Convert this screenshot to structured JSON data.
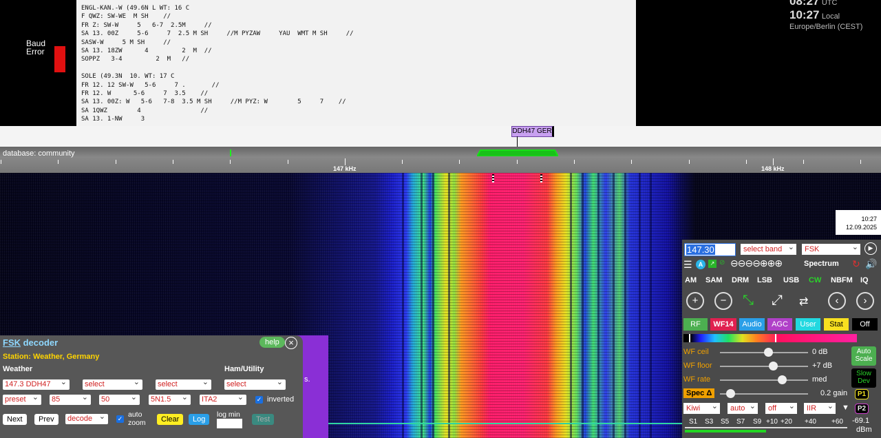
{
  "baud_error": {
    "label_line1": "Baud",
    "label_line2": "Error"
  },
  "console_lines": [
    "ENGL-KAN.-W (49.6N L WT: 16 C",
    "F QWZ: SW-WE  M SH    //",
    "FR Z: SW-W     5   6-7  2.5M     //",
    "SA 13. 00Z     5-6     7  2.5 M SH     //M PYZAW     YAU  WMT M SH     //",
    "SASW-W     5 M SH     //",
    "SA 13. 18ZW      4         2  M  //",
    "SOPPZ   3-4         2  M   //",
    "",
    "SOLE (49.3N  10. WT: 17 C",
    "FR 12. 12 SW-W   5-6     7 .       //",
    "FR 12. W      5-6     7  3.5    //",
    "SA 13. 00Z: W   5-6   7-8  3.5 M SH     //M PYZ: W        5     7    //",
    "SA 1QWZ        4                //",
    "SA 13. 1-NW     3"
  ],
  "clock": {
    "utc_time": "08:27",
    "utc_label": "UTC",
    "local_time": "10:27",
    "local_label": "Local",
    "timezone": "Europe/Berlin (CEST)"
  },
  "station_label": "DDH47 GER",
  "scale": {
    "database": "database: community",
    "label_1": "147 kHz",
    "label_2": "148 kHz"
  },
  "waterfall_timestamp": {
    "time": "10:27",
    "date": "12.09.2025"
  },
  "decoder": {
    "title_link": "FSK",
    "title_rest": " decoder",
    "help": "help",
    "close_icon": "⊗",
    "station": "Station: Weather, Germany",
    "col_weather": "Weather",
    "col_ham": "Ham/Utility",
    "sel_weather": "147.3 DDH47",
    "sel_2": "select",
    "sel_3": "select",
    "sel_ham": "select",
    "sel_preset": "preset",
    "sel_shift": "85",
    "sel_baud": "50",
    "sel_framing": "5N1.5",
    "sel_encoding": "ITA2",
    "inverted_label": "inverted",
    "inverted_checked": true,
    "next": "Next",
    "prev": "Prev",
    "sel_decode": "decode",
    "autozoom_line1": "auto",
    "autozoom_line2": "zoom",
    "clear": "Clear",
    "log": "Log",
    "logmin_label": "log min",
    "test": "Test",
    "purple_text": "s."
  },
  "control": {
    "freq": "147.30",
    "band": "select band",
    "mode_select": "FSK",
    "spectrum": "Spectrum",
    "modes": [
      "AM",
      "SAM",
      "DRM",
      "LSB",
      "USB",
      "CW",
      "NBFM",
      "IQ"
    ],
    "active_mode": "CW",
    "tabs": [
      "RF",
      "WF14",
      "Audio",
      "AGC",
      "User",
      "Stat",
      "Off"
    ],
    "wf_ceil_label": "WF ceil",
    "wf_ceil_value": "0 dB",
    "wf_ceil_level": 0.55,
    "wf_floor_label": "WF floor",
    "wf_floor_value": "+7 dB",
    "wf_floor_level": 0.6,
    "wf_rate_label": "WF rate",
    "wf_rate_value": "med",
    "wf_rate_level": 0.7,
    "spec_label": "Spec Δ",
    "spec_value": "0.2 gain",
    "spec_level": 0.12,
    "auto_scale_line1": "Auto",
    "auto_scale_line2": "Scale",
    "slow_dev_line1": "Slow",
    "slow_dev_line2": "Dev",
    "p1": "P1",
    "p2": "P2",
    "sel_kiwi": "Kiwi",
    "sel_auto": "auto",
    "sel_off": "off",
    "sel_iir": "IIR",
    "smeter_labels": [
      "S1",
      "S3",
      "S5",
      "S7",
      "S9",
      "+10",
      "+20",
      "+40",
      "+60"
    ],
    "smeter_value": "-69.1",
    "smeter_unit": "dBm"
  }
}
